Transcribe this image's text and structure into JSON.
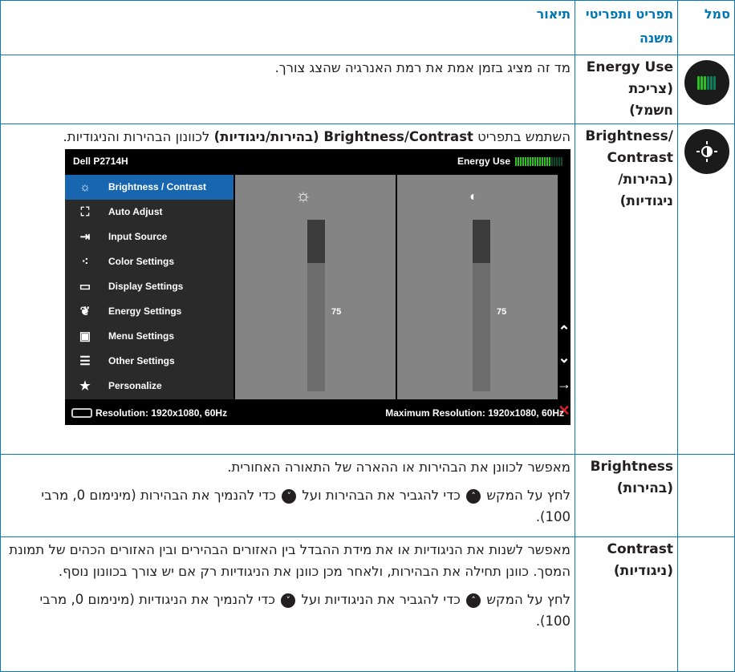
{
  "header": {
    "symbol": "סמל",
    "item": "תפריט ותפריטי משנה",
    "description": "תיאור"
  },
  "rows": [
    {
      "name_en": "Energy Use",
      "name_he": "(צריכת חשמל)",
      "icon": "energy-meter-icon",
      "desc": "מד זה מציג בזמן אמת את רמת האנרגיה שהצג צורך."
    },
    {
      "name_en": "Brightness/ Contrast",
      "name_he": "(בהירות/ ניגודיות)",
      "icon": "brightness-contrast-icon",
      "desc_pre": "השתמש בתפריט ",
      "desc_bold": "Brightness/Contrast (בהירות/ניגודיות)",
      "desc_post": " לכוונון הבהירות והניגודיות."
    },
    {
      "name_en": "Brightness",
      "name_he": "(בהירות)",
      "desc1": "מאפשר לכוונן את הבהירות או ההארה של התאורה האחורית.",
      "desc2_a": "לחץ על המקש ",
      "desc2_b": " כדי להגביר את הבהירות ועל ",
      "desc2_c": " כדי להנמיך את הבהירות (מינימום 0, מרבי 100)."
    },
    {
      "name_en": "Contrast",
      "name_he": "(ניגודיות)",
      "desc1": "מאפשר לשנות את הניגודיות או את מידת ההבדל בין האזורים הבהירים ובין האזורים הכהים של תמונת המסך. כוונן תחילה את הבהירות, ולאחר מכן כוונן את הניגודיות רק אם יש צורך בכוונון נוסף.",
      "desc2_a": "לחץ על המקש ",
      "desc2_b": " כדי להגביר את הניגודיות ועל ",
      "desc2_c": " כדי להנמיך את הניגודיות (מינימום 0, מרבי 100)."
    }
  ],
  "osd": {
    "model": "Dell P2714H",
    "energy_label": "Energy Use",
    "energy_level": 0.75,
    "menu": [
      {
        "label": "Brightness / Contrast",
        "icon": "sun-icon",
        "selected": true
      },
      {
        "label": "Auto Adjust",
        "icon": "auto-adjust-icon"
      },
      {
        "label": "Input Source",
        "icon": "input-source-icon"
      },
      {
        "label": "Color Settings",
        "icon": "color-dots-icon"
      },
      {
        "label": "Display Settings",
        "icon": "display-icon"
      },
      {
        "label": "Energy Settings",
        "icon": "leaf-icon"
      },
      {
        "label": "Menu Settings",
        "icon": "menu-icon"
      },
      {
        "label": "Other Settings",
        "icon": "sliders-icon"
      },
      {
        "label": "Personalize",
        "icon": "star-icon"
      }
    ],
    "brightness_value": "75",
    "contrast_value": "75",
    "brightness_level": 0.75,
    "contrast_level": 0.75,
    "resolution": "Resolution: 1920x1080, 60Hz",
    "max_resolution": "Maximum Resolution: 1920x1080, 60Hz"
  }
}
